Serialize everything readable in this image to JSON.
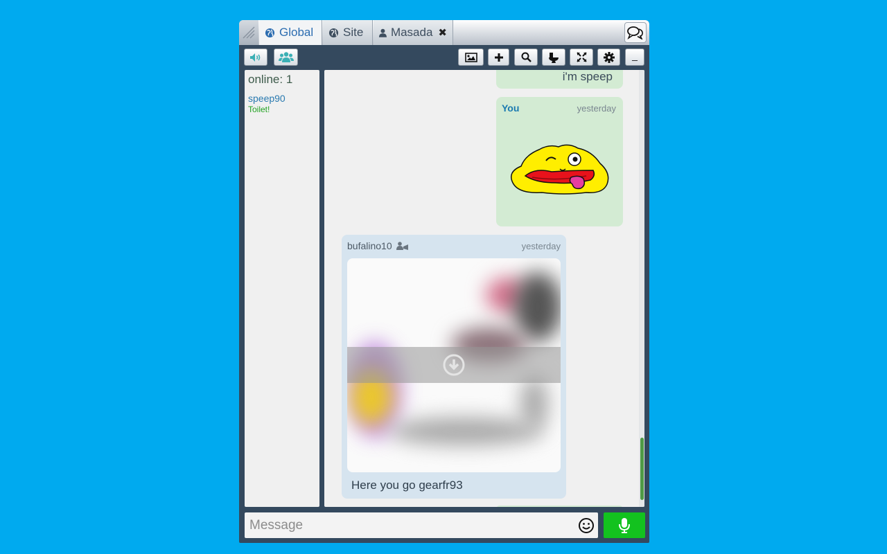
{
  "tabs": [
    {
      "label": "Global",
      "icon": "globe-icon",
      "active": true
    },
    {
      "label": "Site",
      "icon": "globe-icon",
      "active": false
    },
    {
      "label": "Masada",
      "icon": "user-icon",
      "active": false,
      "closable": true
    }
  ],
  "toolbar": {
    "left": [
      "sound-icon",
      "users-icon"
    ],
    "right": [
      "image-icon",
      "plus-icon",
      "search-icon",
      "toilet-icon",
      "fullscreen-icon",
      "gear-icon",
      "minimize-icon"
    ],
    "minimize_label": "_"
  },
  "userlist": {
    "online_label": "online: 1",
    "users": [
      {
        "name": "speep90",
        "status": "Toilet!"
      }
    ]
  },
  "messages": [
    {
      "sender": "",
      "text": "i'm speep",
      "mine": true
    },
    {
      "sender": "You",
      "time": "yesterday",
      "mine": true,
      "sticker": "tongue-out-blob"
    },
    {
      "sender": "bufalino10",
      "time": "yesterday",
      "mine": false,
      "image": "blurred-unicorn-image",
      "text": "Here you go gearfr93"
    }
  ],
  "composer": {
    "placeholder": "Message"
  },
  "colors": {
    "background": "#00aaef",
    "window": "#34495e",
    "mine_bubble": "#d3ebd3",
    "other_bubble": "#d6e4ef",
    "mic": "#13c21f"
  }
}
